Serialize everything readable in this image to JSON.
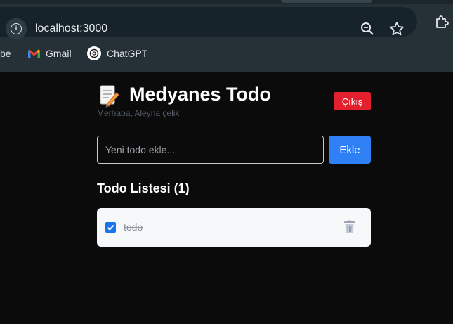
{
  "browser": {
    "url": "localhost:3000",
    "bookmarks": [
      {
        "label": "be"
      },
      {
        "label": "Gmail",
        "icon": "gmail-icon"
      },
      {
        "label": "ChatGPT",
        "icon": "chatgpt-icon"
      }
    ],
    "icons": [
      "info-icon",
      "zoom-icon",
      "star-icon",
      "extensions-icon"
    ]
  },
  "app": {
    "title": "Medyanes Todo",
    "title_icon": "memo-icon",
    "greeting": "Merhaba, Aleyna çelik",
    "logout_label": "Çıkış",
    "input_placeholder": "Yeni todo ekle...",
    "add_label": "Ekle",
    "list_heading": "Todo Listesi (1)",
    "todos": [
      {
        "text": "todo",
        "completed": true
      }
    ]
  },
  "colors": {
    "background": "#0b0b0c",
    "logout": "#e5202e",
    "add_button": "#2f80f5",
    "card": "#f7f8fa"
  }
}
